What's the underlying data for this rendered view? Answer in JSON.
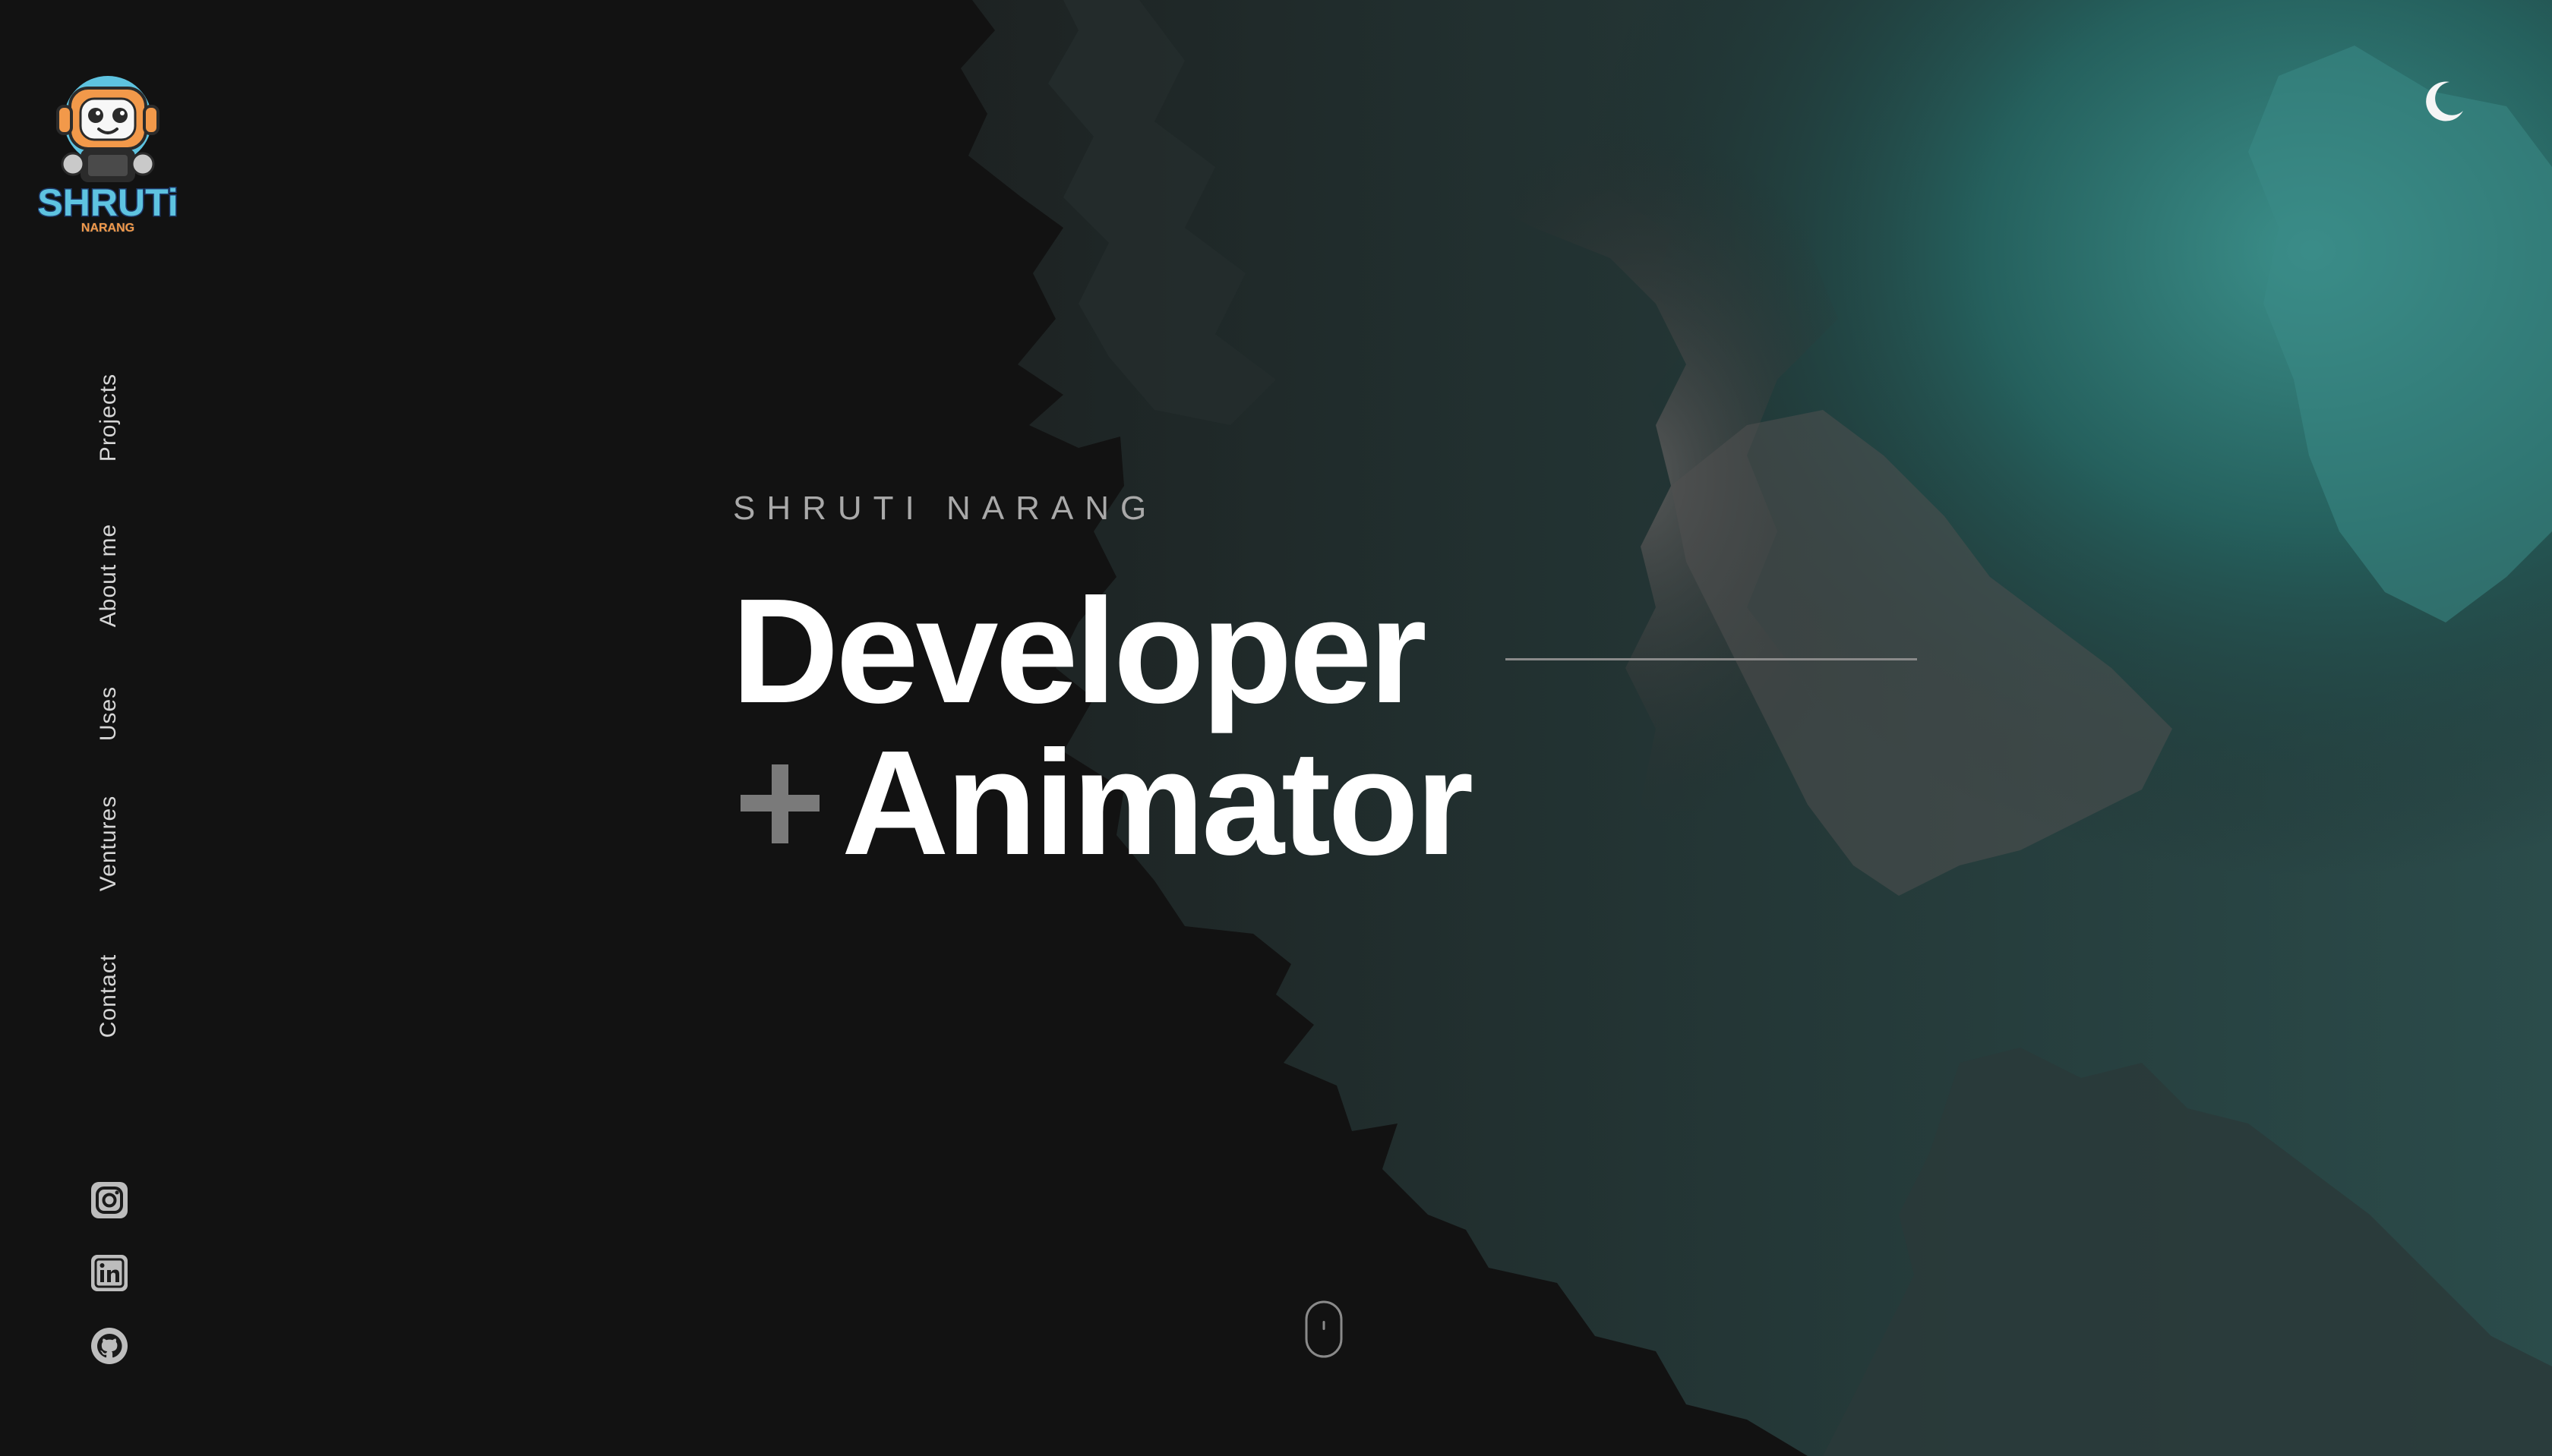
{
  "logo": {
    "primary_text": "SHRUTi",
    "secondary_text": "NARANG",
    "icon": "robot-mascot"
  },
  "theme_toggle": {
    "icon": "moon-icon"
  },
  "nav": {
    "items": [
      {
        "label": "Projects"
      },
      {
        "label": "About me"
      },
      {
        "label": "Uses"
      },
      {
        "label": "Ventures"
      },
      {
        "label": "Contact"
      }
    ]
  },
  "social": [
    {
      "icon": "instagram-icon"
    },
    {
      "icon": "linkedin-icon"
    },
    {
      "icon": "github-icon"
    }
  ],
  "hero": {
    "eyebrow": "SHRUTI NARANG",
    "line1": "Developer",
    "plus": "+",
    "line2": "Animator"
  },
  "scroll_indicator": {
    "icon": "mouse-scroll-icon"
  },
  "colors": {
    "background": "#121212",
    "text": "#ffffff",
    "muted": "#a9a9a9",
    "accent_teal": "#2f7d78",
    "plus": "#7a7a7a"
  }
}
